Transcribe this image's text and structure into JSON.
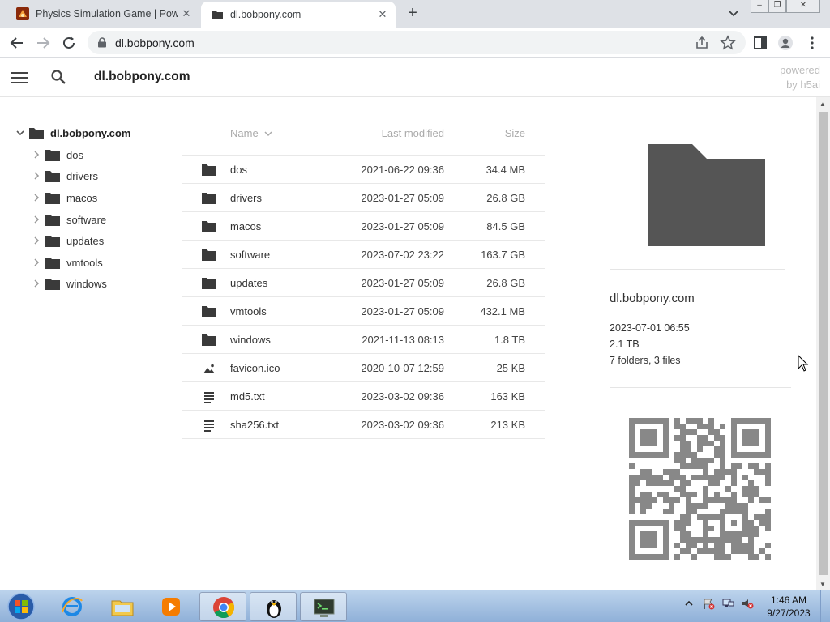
{
  "browser": {
    "tabs": [
      {
        "label": "Physics Simulation Game | Powder",
        "active": false
      },
      {
        "label": "dl.bobpony.com",
        "active": true
      }
    ],
    "new_tab": "+",
    "url": "dl.bobpony.com",
    "window_controls": {
      "minimize": "‒",
      "restore": "❐",
      "close": "✕"
    }
  },
  "header": {
    "title": "dl.bobpony.com",
    "powered_line1": "powered",
    "powered_line2": "by h5ai"
  },
  "tree": {
    "root": "dl.bobpony.com",
    "items": [
      "dos",
      "drivers",
      "macos",
      "software",
      "updates",
      "vmtools",
      "windows"
    ]
  },
  "list": {
    "headers": {
      "name": "Name",
      "modified": "Last modified",
      "size": "Size"
    },
    "sort_indicator": "chevron-down-icon",
    "rows": [
      {
        "icon": "folder-icon",
        "name": "dos",
        "modified": "2021-06-22 09:36",
        "size": "34.4 MB"
      },
      {
        "icon": "folder-icon",
        "name": "drivers",
        "modified": "2023-01-27 05:09",
        "size": "26.8 GB"
      },
      {
        "icon": "folder-icon",
        "name": "macos",
        "modified": "2023-01-27 05:09",
        "size": "84.5 GB"
      },
      {
        "icon": "folder-icon",
        "name": "software",
        "modified": "2023-07-02 23:22",
        "size": "163.7 GB"
      },
      {
        "icon": "folder-icon",
        "name": "updates",
        "modified": "2023-01-27 05:09",
        "size": "26.8 GB"
      },
      {
        "icon": "folder-icon",
        "name": "vmtools",
        "modified": "2023-01-27 05:09",
        "size": "432.1 MB"
      },
      {
        "icon": "folder-icon",
        "name": "windows",
        "modified": "2021-11-13 08:13",
        "size": "1.8 TB"
      },
      {
        "icon": "image-file-icon",
        "name": "favicon.ico",
        "modified": "2020-10-07 12:59",
        "size": "25 KB"
      },
      {
        "icon": "text-file-icon",
        "name": "md5.txt",
        "modified": "2023-03-02 09:36",
        "size": "163 KB"
      },
      {
        "icon": "text-file-icon",
        "name": "sha256.txt",
        "modified": "2023-03-02 09:36",
        "size": "213 KB"
      }
    ]
  },
  "info": {
    "title": "dl.bobpony.com",
    "date": "2023-07-01 06:55",
    "size": "2.1 TB",
    "counts": "7 folders, 3 files"
  },
  "taskbar": {
    "apps": [
      "internet-explorer-icon",
      "file-explorer-icon",
      "media-player-icon",
      "chrome-icon",
      "penguin-app-icon",
      "terminal-icon"
    ],
    "clock_time": "1:46 AM",
    "clock_date": "9/27/2023"
  },
  "colors": {
    "tabstrip": "#dee1e6",
    "icon_dark": "#3a3a3a",
    "folder_large": "#555555",
    "qr": "#888888",
    "taskbar": "#a9c4e6"
  }
}
